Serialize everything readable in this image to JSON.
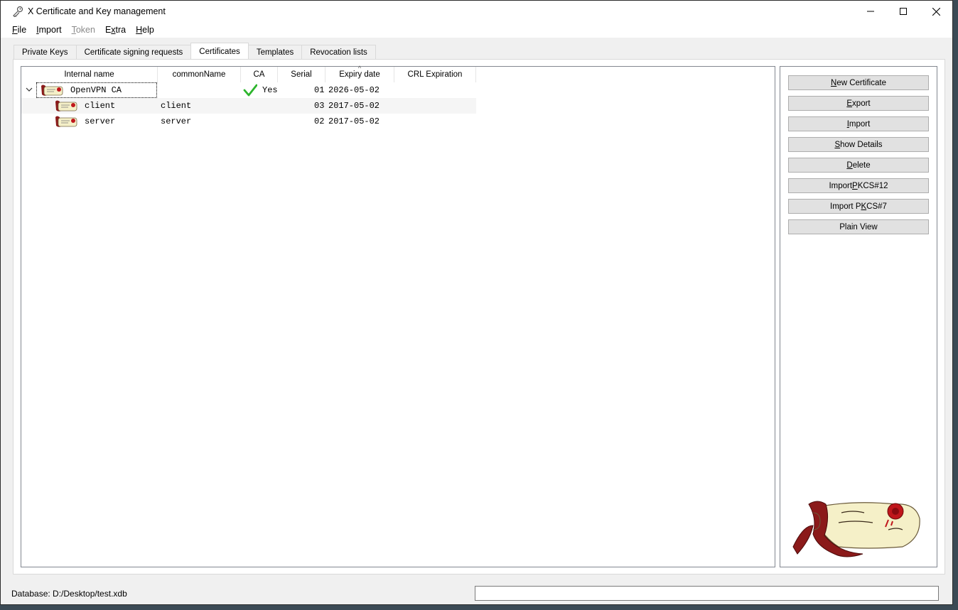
{
  "window": {
    "title": "X Certificate and Key management"
  },
  "menu": [
    {
      "label": "File",
      "disabled": false
    },
    {
      "label": "Import",
      "disabled": false
    },
    {
      "label": "Token",
      "disabled": true
    },
    {
      "label": "Extra",
      "disabled": false
    },
    {
      "label": "Help",
      "disabled": false
    }
  ],
  "tabs": [
    {
      "label": "Private Keys"
    },
    {
      "label": "Certificate signing requests"
    },
    {
      "label": "Certificates",
      "active": true
    },
    {
      "label": "Templates"
    },
    {
      "label": "Revocation lists"
    }
  ],
  "table": {
    "columns": [
      "Internal name",
      "commonName",
      "CA",
      "Serial",
      "Expiry date",
      "CRL Expiration"
    ],
    "sorted_column": "Expiry date",
    "rows": [
      {
        "internal_name": "OpenVPN CA",
        "common_name": "",
        "ca": "Yes",
        "serial": "01",
        "expiry": "2026-05-02",
        "crl_expiration": ""
      },
      {
        "internal_name": "client",
        "common_name": "client",
        "ca": "",
        "serial": "03",
        "expiry": "2017-05-02",
        "crl_expiration": ""
      },
      {
        "internal_name": "server",
        "common_name": "server",
        "ca": "",
        "serial": "02",
        "expiry": "2017-05-02",
        "crl_expiration": ""
      }
    ]
  },
  "buttons": [
    "New Certificate",
    "Export",
    "Import",
    "Show Details",
    "Delete",
    "Import PKCS#12",
    "Import PKCS#7",
    "Plain View"
  ],
  "status": {
    "database": "Database: D:/Desktop/test.xdb",
    "progress_text": ""
  },
  "colors": {
    "check": "#2db52d",
    "scroll_red": "#8b1a1a",
    "scroll_paper": "#f5f0c8"
  },
  "icons": {
    "app": "key-icon",
    "row": "certificate-icon",
    "ca": "check-icon"
  }
}
